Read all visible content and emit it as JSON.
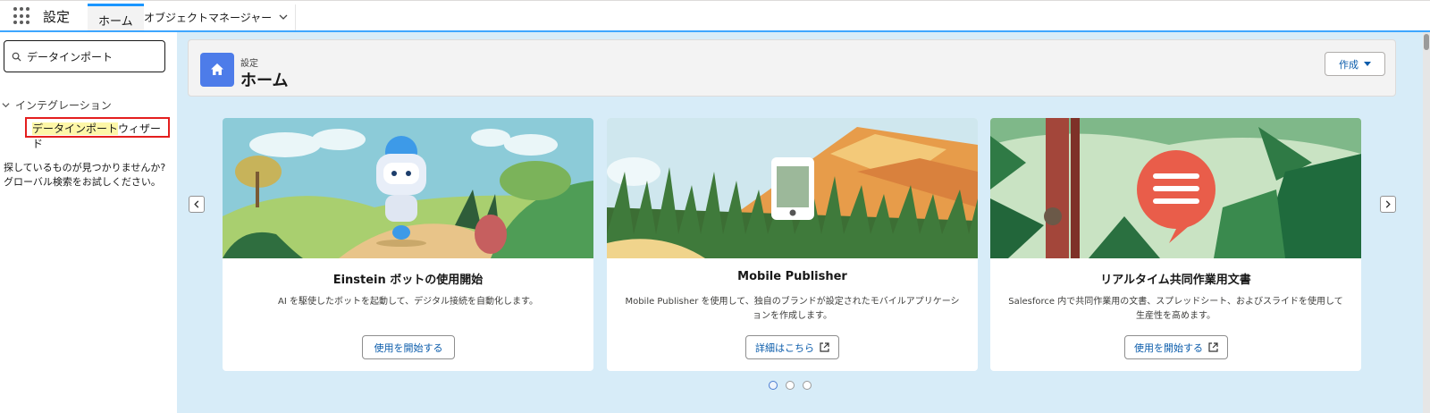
{
  "app": {
    "name": "設定"
  },
  "nav": {
    "tabs": [
      {
        "label": "ホーム",
        "active": true
      },
      {
        "label": "オブジェクトマネージャー",
        "has_dropdown": true
      }
    ]
  },
  "sidebar": {
    "search": {
      "value": "データインポート",
      "placeholder": ""
    },
    "tree": {
      "group_label": "インテグレーション",
      "item": {
        "label_highlight": "データインポート",
        "label_rest": "ウィザード"
      }
    },
    "help_line1": "探しているものが見つかりませんか?",
    "help_line2": "グローバル検索をお試しください。"
  },
  "header": {
    "breadcrumb": "設定",
    "title": "ホーム",
    "create_label": "作成"
  },
  "cards": [
    {
      "title": "Einstein ボットの使用開始",
      "desc": "AI を駆使したボットを起動して、デジタル接続を自動化します。",
      "cta": "使用を開始する",
      "external": false
    },
    {
      "title": "Mobile Publisher",
      "desc": "Mobile Publisher を使用して、独自のブランドが設定されたモバイルアプリケーションを作成します。",
      "cta": "詳細はこちら",
      "external": true
    },
    {
      "title": "リアルタイム共同作業用文書",
      "desc": "Salesforce 内で共同作業用の文書、スプレッドシート、およびスライドを使用して生産性を高めます。",
      "cta": "使用を開始する",
      "external": true
    }
  ],
  "carousel": {
    "page_count": 3,
    "active_index": 0
  },
  "colors": {
    "brand": "#1b96ff",
    "home_badge": "#4d7ce9",
    "link": "#0b5cab",
    "main_background": "#d7ecf8",
    "highlight_border": "#e41e1e"
  },
  "icons": {
    "waffle": "app-launcher-icon",
    "search": "search-icon",
    "home": "home-icon",
    "external": "external-link-icon"
  }
}
